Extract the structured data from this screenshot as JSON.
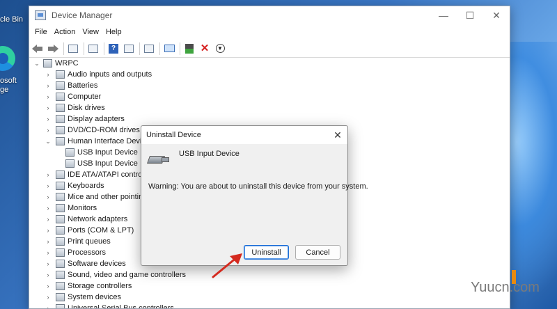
{
  "desktop": {
    "recycle_bin_label": "cle Bin",
    "edge_label_line1": "osoft",
    "edge_label_line2": "ge"
  },
  "window": {
    "title": "Device Manager",
    "controls": {
      "minimize": "—",
      "maximize": "☐",
      "close": "✕"
    }
  },
  "menu": [
    "File",
    "Action",
    "View",
    "Help"
  ],
  "toolbar_icons": [
    "back-icon",
    "forward-icon",
    "show-hide-tree-icon",
    "properties-icon",
    "help-icon",
    "details-view-icon",
    "scan-hardware-icon",
    "monitor-icon",
    "enable-device-icon",
    "uninstall-device-icon",
    "update-driver-icon"
  ],
  "tree": {
    "root": "WRPC",
    "items": [
      {
        "label": "Audio inputs and outputs",
        "expanded": false
      },
      {
        "label": "Batteries",
        "expanded": false
      },
      {
        "label": "Computer",
        "expanded": false
      },
      {
        "label": "Disk drives",
        "expanded": false
      },
      {
        "label": "Display adapters",
        "expanded": false
      },
      {
        "label": "DVD/CD-ROM drives",
        "expanded": false
      },
      {
        "label": "Human Interface Devic",
        "expanded": true
      },
      {
        "label": "USB Input Device",
        "child": true
      },
      {
        "label": "USB Input Device",
        "child": true
      },
      {
        "label": "IDE ATA/ATAPI controll",
        "expanded": false
      },
      {
        "label": "Keyboards",
        "expanded": false
      },
      {
        "label": "Mice and other pointin",
        "expanded": false
      },
      {
        "label": "Monitors",
        "expanded": false
      },
      {
        "label": "Network adapters",
        "expanded": false
      },
      {
        "label": "Ports (COM & LPT)",
        "expanded": false
      },
      {
        "label": "Print queues",
        "expanded": false
      },
      {
        "label": "Processors",
        "expanded": false
      },
      {
        "label": "Software devices",
        "expanded": false
      },
      {
        "label": "Sound, video and game controllers",
        "expanded": false
      },
      {
        "label": "Storage controllers",
        "expanded": false
      },
      {
        "label": "System devices",
        "expanded": false
      },
      {
        "label": "Universal Serial Bus controllers",
        "expanded": false
      }
    ]
  },
  "dialog": {
    "title": "Uninstall Device",
    "device_name": "USB Input Device",
    "warning": "Warning: You are about to uninstall this device from your system.",
    "uninstall_label": "Uninstall",
    "cancel_label": "Cancel",
    "close_glyph": "✕"
  },
  "watermark": "Yuucn.com",
  "colors": {
    "accent": "#1f6fd6",
    "arrow": "#d42a1f",
    "delete_x": "#d62020"
  }
}
